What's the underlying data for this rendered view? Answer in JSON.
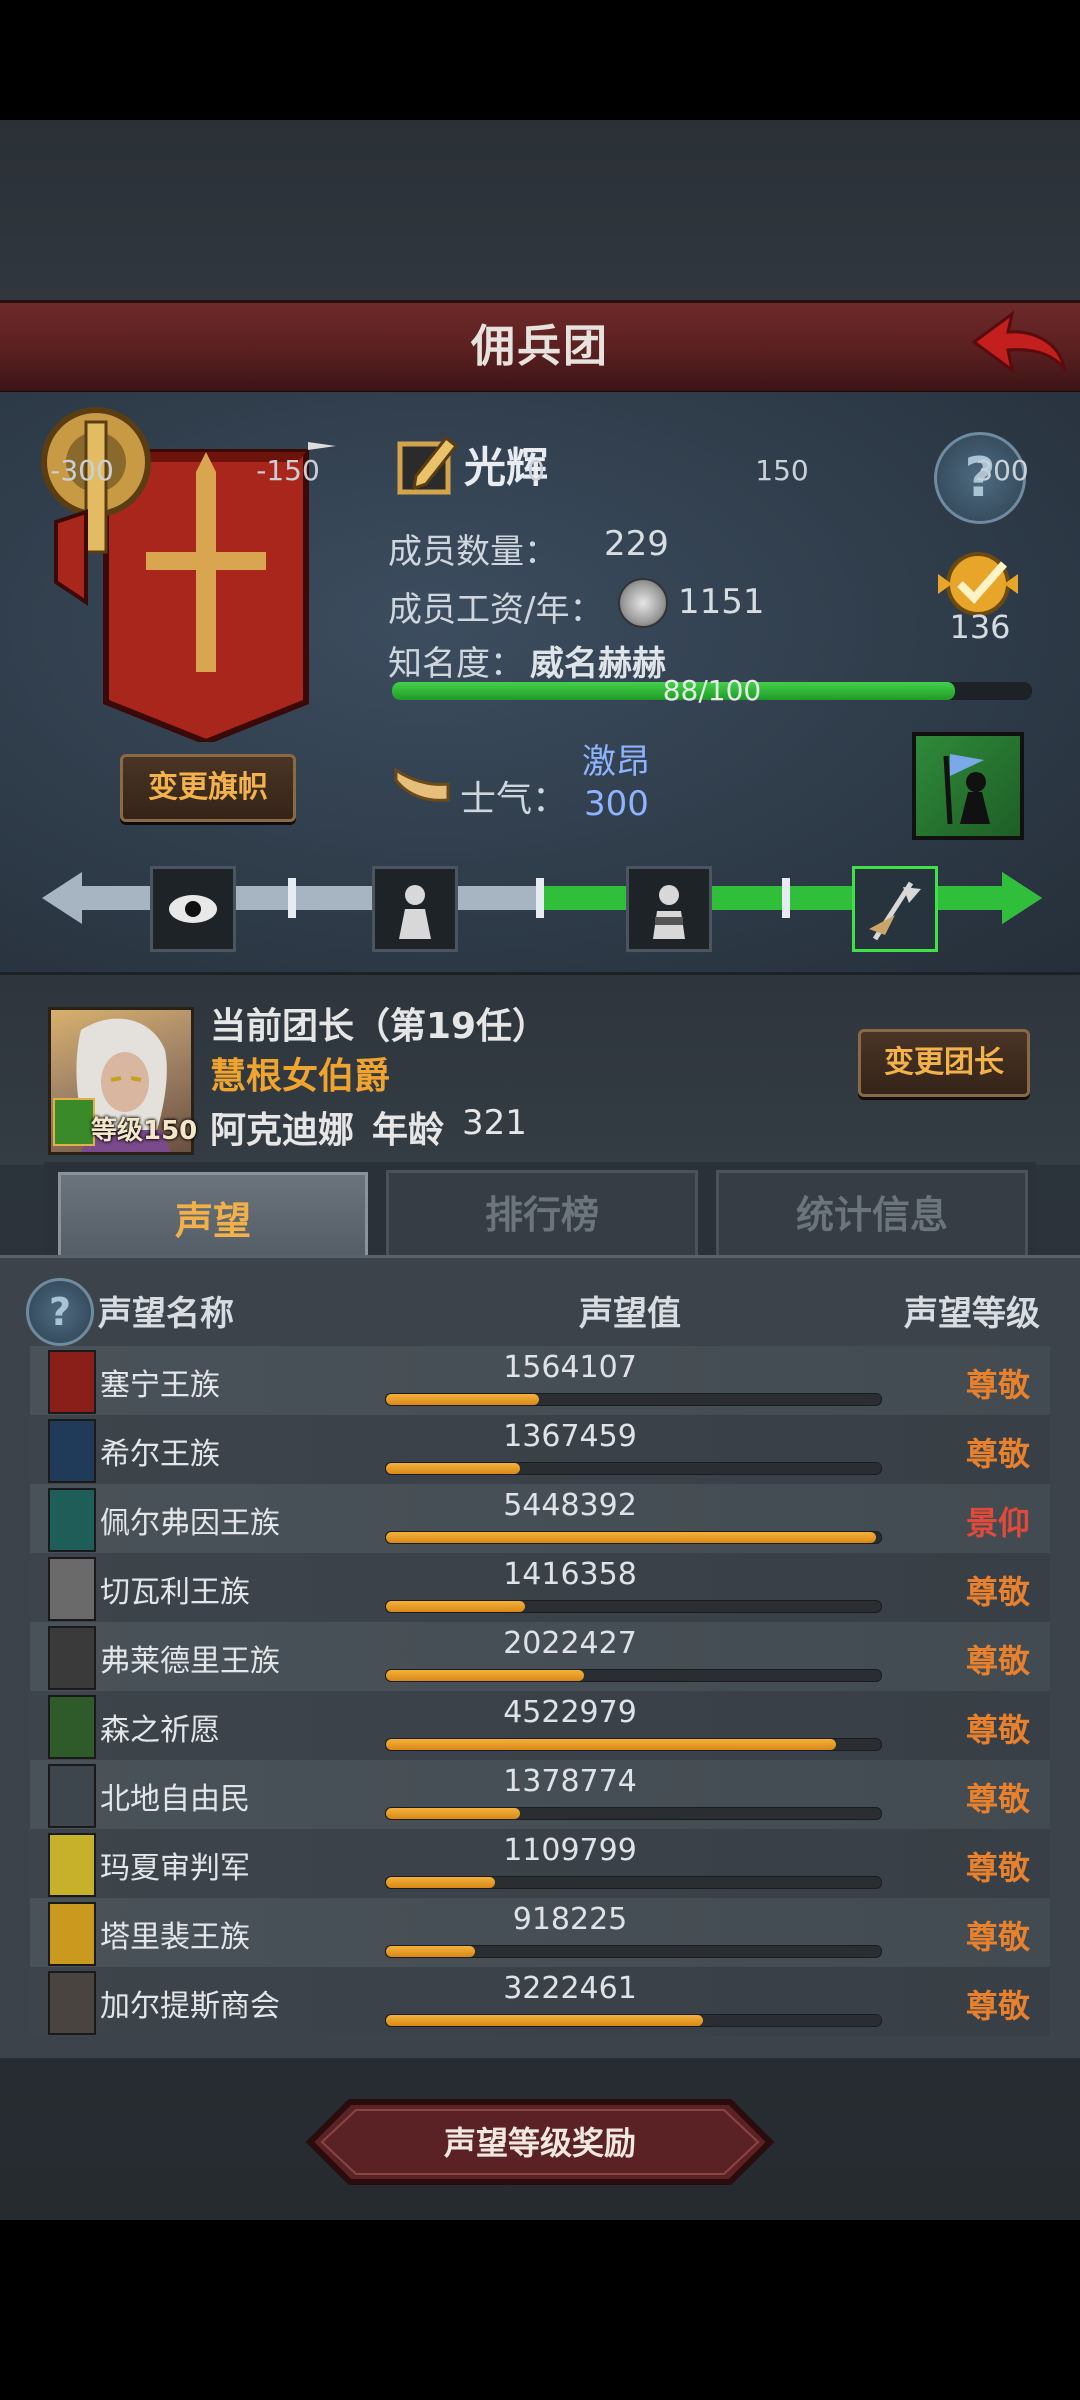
{
  "header": {
    "title": "佣兵团"
  },
  "guild": {
    "name": "光辉",
    "members_label": "成员数量：",
    "members_value": "229",
    "salary_label": "成员工资/年：",
    "salary_value": "1151",
    "fame_label": "知名度：",
    "fame_value": "威名赫赫",
    "fame_progress_text": "88/100",
    "fame_progress": 0.88,
    "change_banner_label": "变更旗帜",
    "rank_value": "136",
    "help_icon": "question-icon"
  },
  "morale": {
    "label": "士气：",
    "state": "激昂",
    "value": "300",
    "level": 300,
    "scale_min": -300,
    "scale_max": 300,
    "ticks": [
      "-300",
      "-150",
      "0",
      "150",
      "300"
    ]
  },
  "leader": {
    "title": "当前团长（第19任）",
    "rank": "慧根女伯爵",
    "name": "阿克迪娜",
    "age_label": "年龄",
    "age_value": "321",
    "level_text": "等级150",
    "change_leader_label": "变更团长"
  },
  "tabs": [
    {
      "label": "声望",
      "active": true
    },
    {
      "label": "排行榜",
      "active": false
    },
    {
      "label": "统计信息",
      "active": false
    }
  ],
  "table": {
    "headers": {
      "name": "声望名称",
      "value": "声望值",
      "level": "声望等级"
    },
    "rows": [
      {
        "name": "塞宁王族",
        "value": "1564107",
        "fill": 0.31,
        "level": "尊敬",
        "emblem": "#8a1f1a"
      },
      {
        "name": "希尔王族",
        "value": "1367459",
        "fill": 0.27,
        "level": "尊敬",
        "emblem": "#203a5a"
      },
      {
        "name": "佩尔弗因王族",
        "value": "5448392",
        "fill": 0.99,
        "level": "景仰",
        "emblem": "#1f5e58"
      },
      {
        "name": "切瓦利王族",
        "value": "1416358",
        "fill": 0.28,
        "level": "尊敬",
        "emblem": "#6a6a6a"
      },
      {
        "name": "弗莱德里王族",
        "value": "2022427",
        "fill": 0.4,
        "level": "尊敬",
        "emblem": "#3a3a3a"
      },
      {
        "name": "森之祈愿",
        "value": "4522979",
        "fill": 0.91,
        "level": "尊敬",
        "emblem": "#2f5a2a"
      },
      {
        "name": "北地自由民",
        "value": "1378774",
        "fill": 0.27,
        "level": "尊敬",
        "emblem": "#3d454d"
      },
      {
        "name": "玛夏审判军",
        "value": "1109799",
        "fill": 0.22,
        "level": "尊敬",
        "emblem": "#c7b12a"
      },
      {
        "name": "塔里裴王族",
        "value": "918225",
        "fill": 0.18,
        "level": "尊敬",
        "emblem": "#c99a1e"
      },
      {
        "name": "加尔提斯商会",
        "value": "3222461",
        "fill": 0.64,
        "level": "尊敬",
        "emblem": "#4a4440"
      }
    ]
  },
  "footer": {
    "reward_button_label": "声望等级奖励"
  },
  "colors": {
    "respect": "#e8812e",
    "admire": "#e04a3a",
    "accent_gold": "#f3b24a",
    "morale_green": "#2fbf3a"
  }
}
